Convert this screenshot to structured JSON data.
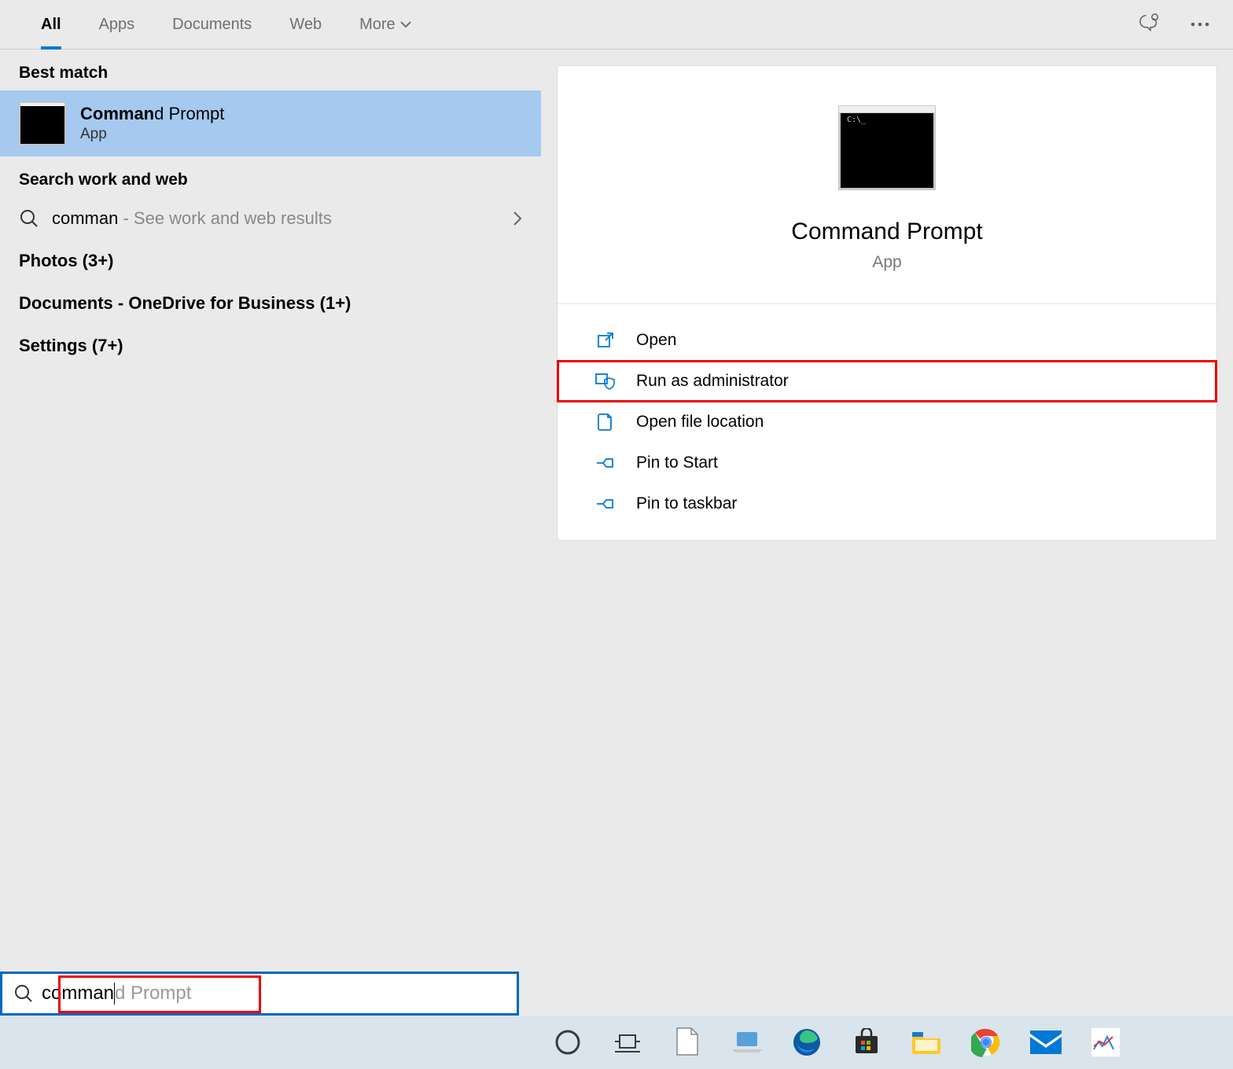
{
  "tabs": {
    "all": "All",
    "apps": "Apps",
    "documents": "Documents",
    "web": "Web",
    "more": "More"
  },
  "left": {
    "best_match": "Best match",
    "result": {
      "title_bold": "Comman",
      "title_rest": "d Prompt",
      "sub": "App"
    },
    "search_work_web": "Search work and web",
    "web_result": {
      "typed": "comman",
      "hint": " - See work and web results"
    },
    "photos": "Photos (3+)",
    "documents": "Documents - OneDrive for Business (1+)",
    "settings": "Settings (7+)"
  },
  "detail": {
    "title": "Command Prompt",
    "sub": "App",
    "actions": {
      "open": "Open",
      "run_admin": "Run as administrator",
      "open_location": "Open file location",
      "pin_start": "Pin to Start",
      "pin_taskbar": "Pin to taskbar"
    }
  },
  "search": {
    "typed": "comman",
    "suggest": "d Prompt"
  }
}
